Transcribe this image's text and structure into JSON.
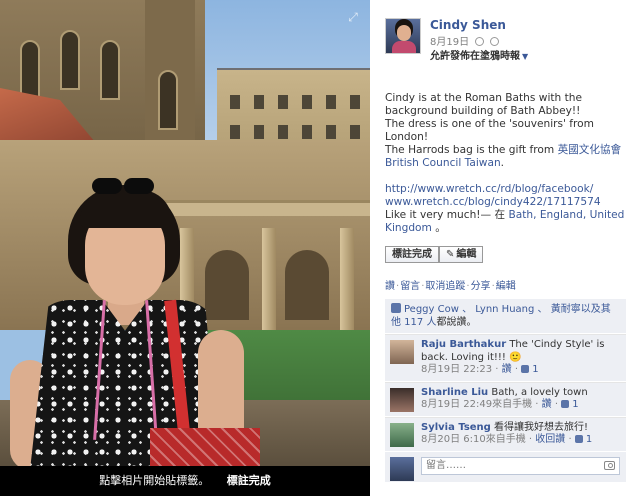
{
  "photo": {
    "caption_text": "點擊相片開始貼標籤。",
    "caption_done": "標註完成",
    "expand_icon": "expand-icon"
  },
  "post": {
    "author": "Cindy Shen",
    "date": "8月19日",
    "privacy_label": "允許發佈在塗鴉時報",
    "body": [
      "Cindy is at the Roman Baths with the background building of Bath Abbey!!",
      "The dress is one of the 'souvenirs' from London!",
      "The Harrods bag is the gift from ",
      "英國文化協會 British Council Taiwan",
      "."
    ],
    "link_url": "http://www.wretch.cc/rd/blog/facebook/ www.wretch.cc/blog/cindy422/17117574",
    "like_line_prefix": "Like it very much!— 在 ",
    "place": "Bath, England, United Kingdom",
    "place_suffix": " 。",
    "tag_done_button": "標註完成",
    "edit_button": "編輯"
  },
  "actions": [
    "讚",
    "留言",
    "取消追蹤",
    "分享",
    "編輯"
  ],
  "likes_text": {
    "names": "Peggy Cow 、 Lynn Huang 、 黃耐寧以及其他 117 人",
    "suffix": "都說讚。"
  },
  "comments": [
    {
      "author": "Raju Barthakur",
      "text": "The 'Cindy Style' is back. Loving it!!! 🙂",
      "time": "8月19日 22:23",
      "action": "讚",
      "likes": "1"
    },
    {
      "author": "Sharline Liu",
      "text": "Bath, a lovely town",
      "time": "8月19日 22:49來自手機",
      "action": "讚",
      "likes": "1"
    },
    {
      "author": "Sylvia Tseng",
      "text": "看得讓我好想去旅行!",
      "time": "8月20日 6:10來自手機",
      "action": "收回讚",
      "likes": "1"
    }
  ],
  "comment_box": {
    "placeholder": "留言……",
    "icon": "camera-icon"
  },
  "colors": {
    "link": "#3b5998",
    "panel_bg": "#edeff4"
  }
}
